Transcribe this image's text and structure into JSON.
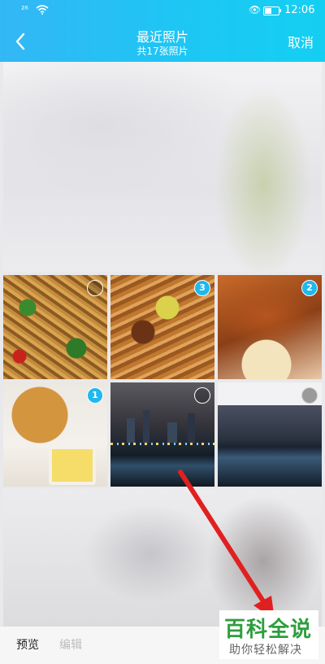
{
  "status_bar": {
    "signal": "²⁶",
    "time": "12:06"
  },
  "header": {
    "title": "最近照片",
    "subtitle": "共17张照片",
    "cancel_label": "取消"
  },
  "photos": [
    {
      "badge": ""
    },
    {
      "badge": "3"
    },
    {
      "badge": "2"
    },
    {
      "badge": "1"
    },
    {
      "badge": ""
    },
    {
      "badge": ""
    }
  ],
  "bottom_bar": {
    "preview_label": "预览",
    "edit_label": "编辑"
  },
  "watermark": {
    "main": "百科全说",
    "sub": "助你轻松解决"
  },
  "colors": {
    "header_start": "#33b7f5",
    "header_end": "#14cff2",
    "badge": "#1fb8ef",
    "arrow": "#e02020",
    "watermark_green": "#2d9e3c"
  },
  "icons": [
    "back-chevron-icon",
    "wifi-icon",
    "eye-icon",
    "battery-icon",
    "arrow-annotation"
  ]
}
